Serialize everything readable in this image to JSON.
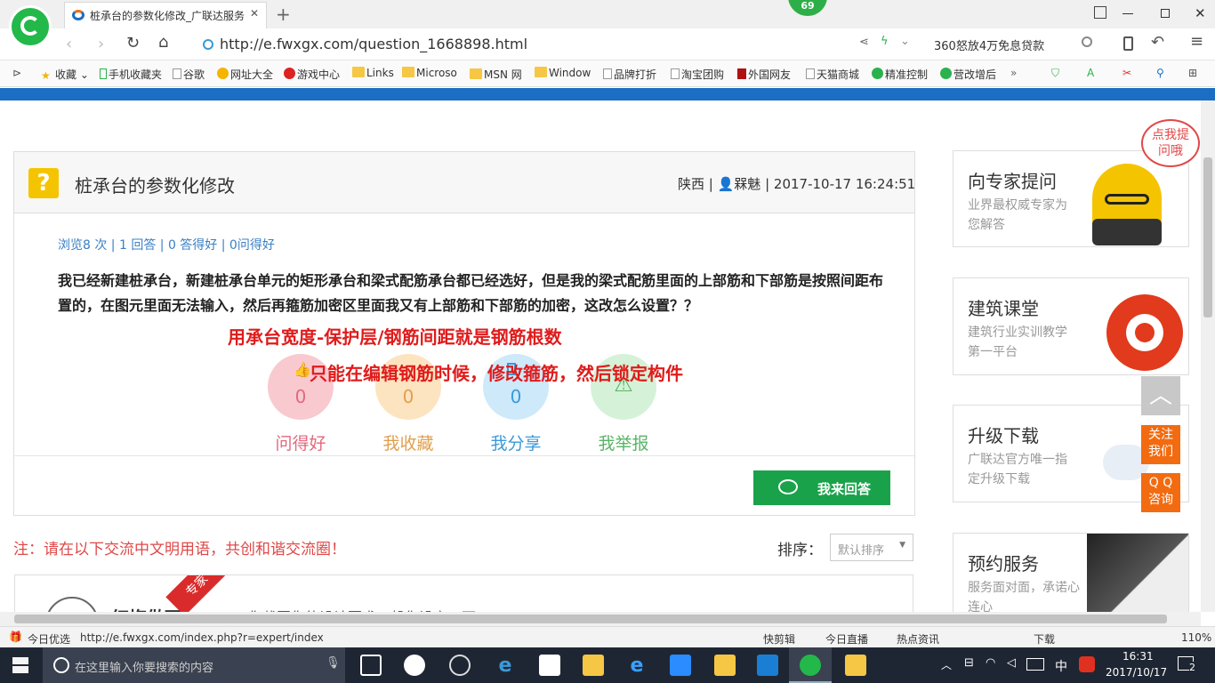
{
  "browser": {
    "tab_title": "桩承台的参数化修改_广联达服务",
    "badge": "69",
    "url": "http://e.fwxgx.com/question_1668898.html",
    "promo": "360怒放4万免息贷款",
    "bookmarks": [
      "收藏",
      "手机收藏夹",
      "谷歌",
      "网址大全",
      "游戏中心",
      "Links",
      "Microso",
      "MSN 网",
      "Window",
      "品牌打折",
      "淘宝团购",
      "外国网友",
      "天猫商城",
      "精准控制",
      "营改增后"
    ]
  },
  "question": {
    "title": "桩承台的参数化修改",
    "region": "陕西",
    "user": "槑魅",
    "datetime": "2017-10-17 16:24:51",
    "stats": "浏览8 次 | 1 回答 | 0 答得好 | 0问得好",
    "body": "我已经新建桩承台，新建桩承台单元的矩形承台和梁式配筋承台都已经选好，但是我的梁式配筋里面的上部筋和下部筋是按照间距布置的，在图元里面无法输入，然后再箍筋加密区里面我又有上部筋和下部筋的加密，这改怎么设置？？",
    "annotation1": "用承台宽度-保护层/钢筋间距就是钢筋根数",
    "annotation2": "只能在编辑钢筋时候，修改箍筋，然后锁定构件",
    "actions": [
      {
        "label": "问得好",
        "count": "0",
        "color": "#f9c9d0",
        "text": "#e26a7e"
      },
      {
        "label": "我收藏",
        "count": "0",
        "color": "#fde4c0",
        "text": "#e0a050"
      },
      {
        "label": "我分享",
        "count": "0",
        "color": "#cde9fa",
        "text": "#3a9ad9"
      },
      {
        "label": "我举报",
        "count": "",
        "color": "#d5f2d8",
        "text": "#59b468"
      }
    ],
    "answer_button": "我来回答"
  },
  "notice": "注：请在以下交流中文明用语，共创和谐交流圈！",
  "sort": {
    "label": "排序：",
    "value": "默认排序"
  },
  "answer_preview": {
    "name": "红梅做雨",
    "snippet": "您截图您的设计要求一般您设定一下",
    "badge": "专家"
  },
  "sidebar": {
    "bubble": "点我提问哦",
    "cards": [
      {
        "title": "向专家提问",
        "sub": "业界最权威专家为您解答"
      },
      {
        "title": "建筑课堂",
        "sub": "建筑行业实训教学第一平台"
      },
      {
        "title": "升级下载",
        "sub": "广联达官方唯一指定升级下载"
      },
      {
        "title": "预约服务",
        "sub": "服务面对面，承诺心连心"
      }
    ],
    "follow": "关注我们",
    "qq": "Q Q 咨询"
  },
  "statusbar": {
    "left": "今日优选",
    "url": "http://e.fwxgx.com/index.php?r=expert/index",
    "items": [
      "快剪辑",
      "今日直播",
      "热点资讯",
      "下载"
    ],
    "zoom": "110%"
  },
  "taskbar": {
    "search": "在这里输入你要搜索的内容",
    "ime": "中",
    "time": "16:31",
    "date": "2017/10/17",
    "notif": "2"
  },
  "colors": {
    "accent": "#1a6fc4",
    "answer_btn": "#1aa24a",
    "orange": "#f26b10",
    "annot": "#e01b1b"
  }
}
